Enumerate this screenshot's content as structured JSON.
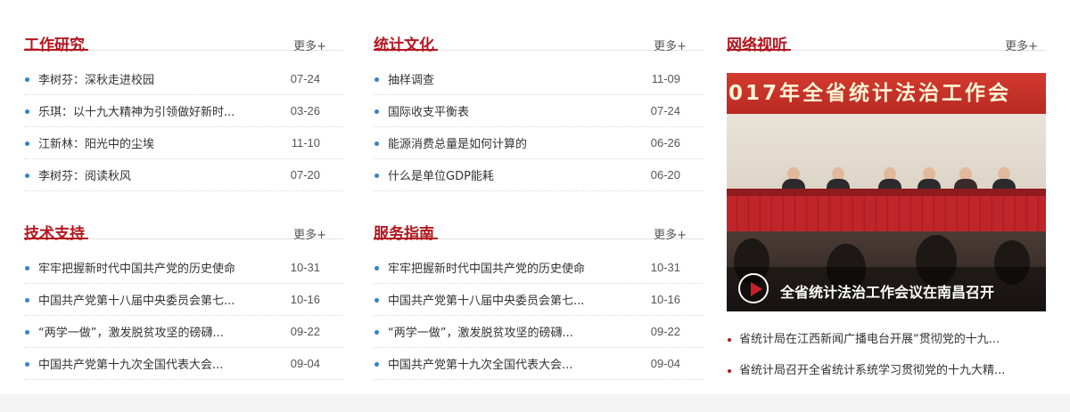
{
  "more_label": "更多+",
  "colors": {
    "accent": "#b5161e",
    "bullet": "#2f83cf"
  },
  "sections": [
    {
      "title": "工作研究",
      "items": [
        {
          "title": "李树芬：深秋走进校园",
          "date": "07-24"
        },
        {
          "title": "乐琪：以十九大精神为引领做好新时...",
          "date": "03-26"
        },
        {
          "title": "江新林：阳光中的尘埃",
          "date": "11-10"
        },
        {
          "title": "李树芬：阅读秋风",
          "date": "07-20"
        }
      ]
    },
    {
      "title": "统计文化",
      "items": [
        {
          "title": "抽样调查",
          "date": "11-09"
        },
        {
          "title": "国际收支平衡表",
          "date": "07-24"
        },
        {
          "title": "能源消费总量是如何计算的",
          "date": "06-26"
        },
        {
          "title": "什么是单位GDP能耗",
          "date": "06-20"
        }
      ]
    },
    {
      "title": "技术支持",
      "items": [
        {
          "title": "牢牢把握新时代中国共产党的历史使命",
          "date": "10-31"
        },
        {
          "title": "中国共产党第十八届中央委员会第七...",
          "date": "10-16"
        },
        {
          "title": "“两学一做”，激发脱贫攻坚的磅礴...",
          "date": "09-22"
        },
        {
          "title": "中国共产党第十九次全国代表大会...",
          "date": "09-04"
        }
      ]
    },
    {
      "title": "服务指南",
      "items": [
        {
          "title": "牢牢把握新时代中国共产党的历史使命",
          "date": "10-31"
        },
        {
          "title": "中国共产党第十八届中央委员会第七...",
          "date": "10-16"
        },
        {
          "title": "“两学一做”，激发脱贫攻坚的磅礴...",
          "date": "09-22"
        },
        {
          "title": "中国共产党第十九次全国代表大会...",
          "date": "09-04"
        }
      ]
    }
  ],
  "video_section": {
    "title": "网络视听",
    "banner_text": "017年全省统计法治工作会",
    "caption": "全省统计法治工作会议在南昌召开",
    "play_icon": "play-icon",
    "news": [
      {
        "title": "省统计局在江西新闻广播电台开展“贯彻党的十九..."
      },
      {
        "title": "省统计局召开全省统计系统学习贯彻党的十九大精..."
      }
    ]
  }
}
